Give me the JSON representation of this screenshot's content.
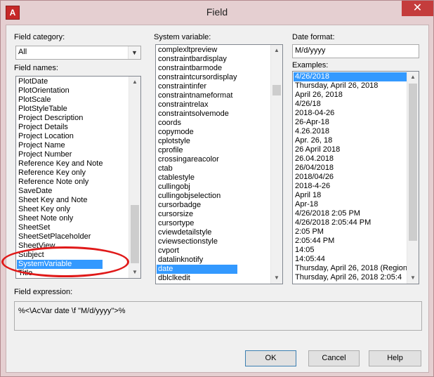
{
  "window": {
    "title": "Field",
    "close_glyph": "✕",
    "app_icon_letter": "A"
  },
  "field_category": {
    "label": "Field category:",
    "selected": "All"
  },
  "field_names": {
    "label": "Field names:",
    "items": [
      "PlotDate",
      "PlotOrientation",
      "PlotScale",
      "PlotStyleTable",
      "Project Description",
      "Project Details",
      "Project Location",
      "Project Name",
      "Project Number",
      "Reference Key and Note",
      "Reference Key only",
      "Reference Note only",
      "SaveDate",
      "Sheet Key and Note",
      "Sheet Key only",
      "Sheet Note only",
      "SheetSet",
      "SheetSetPlaceholder",
      "SheetView",
      "Subject",
      "SystemVariable",
      "Title"
    ],
    "selected_index": 20
  },
  "system_variable": {
    "label": "System variable:",
    "items": [
      "complexltpreview",
      "constraintbardisplay",
      "constraintbarmode",
      "constraintcursordisplay",
      "constraintinfer",
      "constraintnameformat",
      "constraintrelax",
      "constraintsolvemode",
      "coords",
      "copymode",
      "cplotstyle",
      "cprofile",
      "crossingareacolor",
      "ctab",
      "ctablestyle",
      "cullingobj",
      "cullingobjselection",
      "cursorbadge",
      "cursorsize",
      "cursortype",
      "cviewdetailstyle",
      "cviewsectionstyle",
      "cvport",
      "datalinknotify",
      "date",
      "dblclkedit"
    ],
    "selected_index": 24
  },
  "date_format": {
    "label": "Date format:",
    "value": "M/d/yyyy"
  },
  "examples": {
    "label": "Examples:",
    "items": [
      "4/26/2018",
      "Thursday, April 26, 2018",
      "April 26, 2018",
      "4/26/18",
      "2018-04-26",
      "26-Apr-18",
      "4.26.2018",
      "Apr. 26, 18",
      "26 April 2018",
      "26.04.2018",
      "26/04/2018",
      "2018/04/26",
      "2018-4-26",
      "April 18",
      "Apr-18",
      "4/26/2018 2:05 PM",
      "4/26/2018 2:05:44 PM",
      "2:05 PM",
      "2:05:44 PM",
      "14:05",
      "14:05:44",
      "Thursday, April 26, 2018 (Region",
      "Thursday, April 26, 2018 2:05:4"
    ],
    "selected_index": 0
  },
  "field_expression": {
    "label": "Field expression:",
    "value": "%<\\AcVar date \\f \"M/d/yyyy\">%"
  },
  "buttons": {
    "ok": "OK",
    "cancel": "Cancel",
    "help": "Help"
  },
  "colors": {
    "selection": "#3399ff",
    "title_bg": "#e5cfd1",
    "close_bg": "#c43c3c",
    "annotation_ring": "#e01919"
  }
}
